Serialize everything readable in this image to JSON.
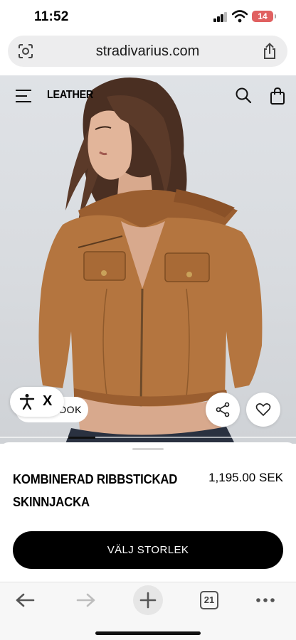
{
  "status_bar": {
    "time": "11:52",
    "battery": "14"
  },
  "browser": {
    "url": "stradivarius.com",
    "tab_count": "21"
  },
  "header": {
    "category": "LEATHER"
  },
  "gallery": {
    "look_label": "LOOK",
    "close_label": "X"
  },
  "product": {
    "name": "KOMBINERAD RIBBSTICKAD SKINNJACKA",
    "price": "1,195.00 SEK",
    "size_button": "VÄLJ STORLEK"
  },
  "colors": {
    "accent": "#000000",
    "jacket": "#b4753f",
    "background": "#dcdfe3"
  },
  "icons": {
    "url_left": "lens-icon",
    "url_right": "share-icon",
    "menu": "hamburger-icon",
    "search": "search-icon",
    "bag": "shopping-bag-icon",
    "accessibility": "accessibility-icon",
    "share": "share-network-icon",
    "favorite": "heart-icon",
    "back": "arrow-left-icon",
    "forward": "arrow-right-icon",
    "new_tab": "plus-icon",
    "more": "more-icon"
  }
}
